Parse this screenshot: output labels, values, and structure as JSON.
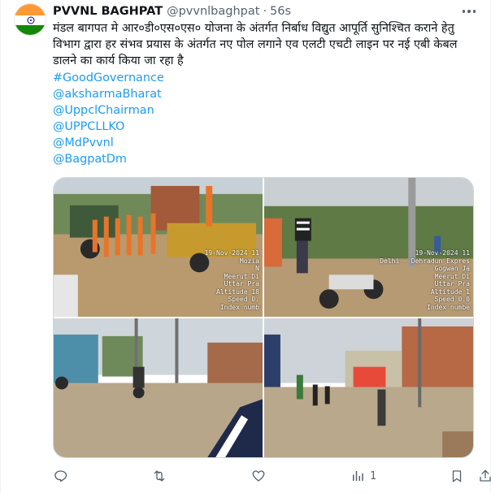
{
  "tweet": {
    "author_name": "PVVNL BAGHPAT",
    "author_handle": "@pvvnlbaghpat",
    "separator": "·",
    "time": "56s",
    "text": "मंडल बागपत मे आर०डी०एस०एस० योजना के अंतर्गत निर्बाध विद्युत आपूर्ति सुनिश्चित कराने हेतु विभाग द्वारा हर संभव प्रयास के अंतर्गत नए पोल लगाने एव एलटी एचटी लाइन पर नई एबी केबल डालने का कार्य किया जा रहा है",
    "hashtags": [
      "#GoodGovernance"
    ],
    "mentions": [
      "@aksharmaBharat",
      "@UppclChairman",
      "@UPPCLLKO",
      "@MdPvvnl",
      "@BagpatDm"
    ]
  },
  "media": [
    {
      "stamp": [
        "19-Nov-2024 11",
        "Mozia",
        "N",
        "Meerut Di",
        "Uttar Pra",
        "Altitude 18",
        "Speed 0.",
        "Index numb"
      ]
    },
    {
      "stamp": [
        "19-Nov-2024 11",
        "Delhi - Dehradun Expres",
        "Gogwan Ja",
        "Meerut Di",
        "Uttar Pra",
        "Altitude 1",
        "Speed 0.0",
        "Index numbe"
      ]
    },
    {
      "stamp": []
    },
    {
      "stamp": []
    }
  ],
  "actions": {
    "reply_count": "",
    "retweet_count": "",
    "like_count": "",
    "views_count": "1"
  },
  "icons": [
    "avatar-flag",
    "more-icon",
    "reply-icon",
    "retweet-icon",
    "like-icon",
    "views-icon",
    "bookmark-icon",
    "share-icon"
  ],
  "colors": {
    "link": "#1d9bf0",
    "muted": "#536471",
    "text": "#0f1419",
    "saffron": "#ff9933",
    "green": "#138808"
  }
}
